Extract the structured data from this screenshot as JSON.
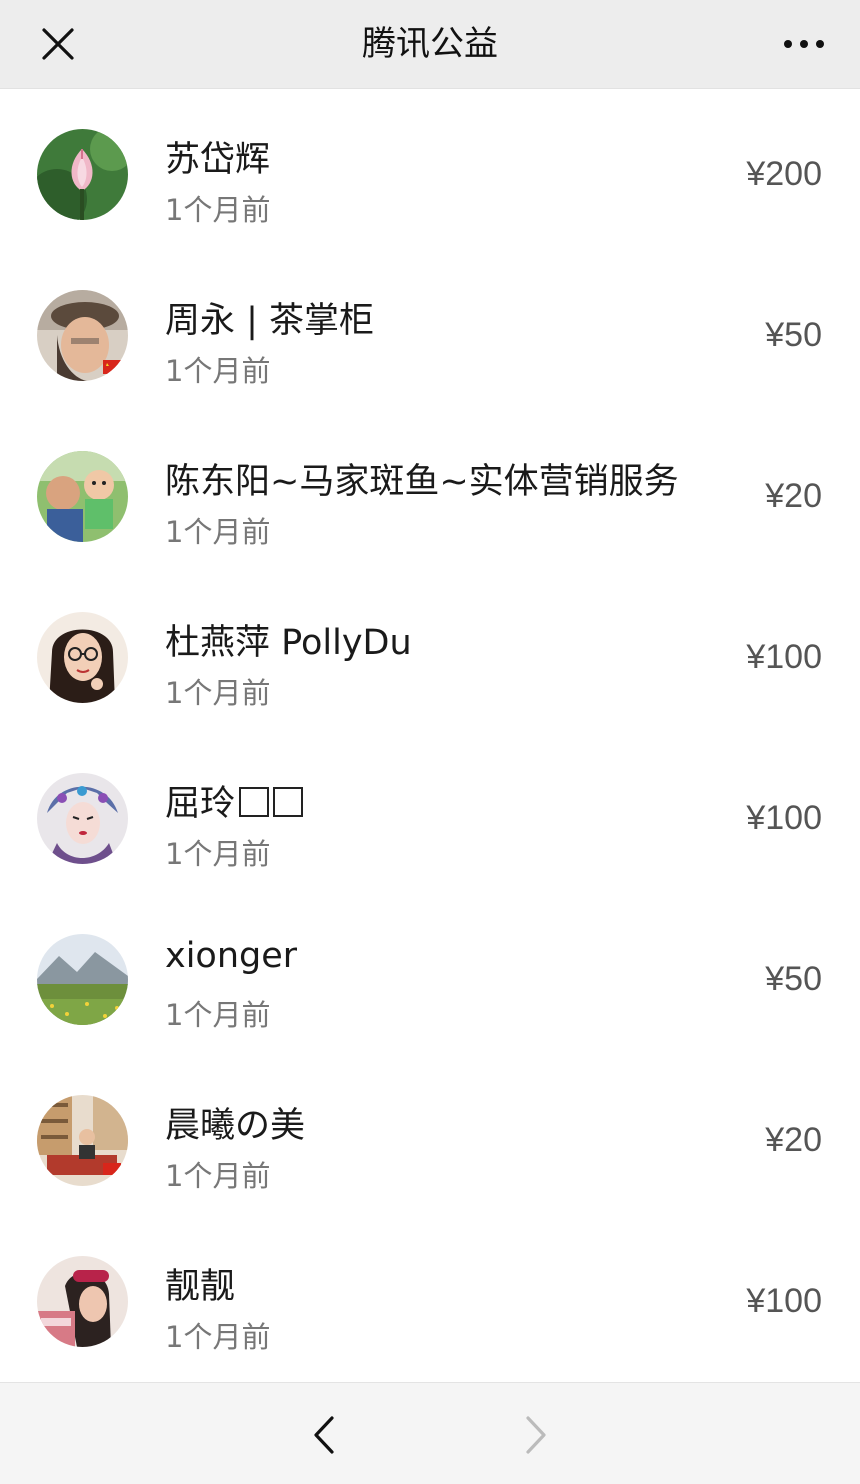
{
  "topbar": {
    "title": "腾讯公益",
    "close_icon": "close-icon",
    "more_icon": "more-icon"
  },
  "donors": [
    {
      "name": "苏岱辉",
      "time": "1个月前",
      "amount": "¥200",
      "avatar": "lotus-flower"
    },
    {
      "name": "周永 | 茶掌柜",
      "time": "1个月前",
      "amount": "¥50",
      "avatar": "person-hat"
    },
    {
      "name": "陈东阳~马家斑鱼~实体营销服务",
      "time": "1个月前",
      "amount": "¥20",
      "avatar": "man-with-baby"
    },
    {
      "name": "杜燕萍 PollyDu",
      "time": "1个月前",
      "amount": "¥100",
      "avatar": "woman-glasses"
    },
    {
      "name": "屈玲",
      "time": "1个月前",
      "amount": "¥100",
      "avatar": "opera-costume"
    },
    {
      "name": "xionger",
      "time": "1个月前",
      "amount": "¥50",
      "avatar": "mountain-meadow"
    },
    {
      "name": "晨曦の美",
      "time": "1个月前",
      "amount": "¥20",
      "avatar": "room-interior"
    },
    {
      "name": "靓靓",
      "time": "1个月前",
      "amount": "¥100",
      "avatar": "woman-portrait"
    }
  ],
  "bottombar": {
    "back_icon": "chevron-left-icon",
    "forward_icon": "chevron-right-icon"
  },
  "colors": {
    "topbar_bg": "#ededed",
    "bottombar_bg": "#f5f5f5",
    "amount": "#555555",
    "time": "#777777"
  }
}
